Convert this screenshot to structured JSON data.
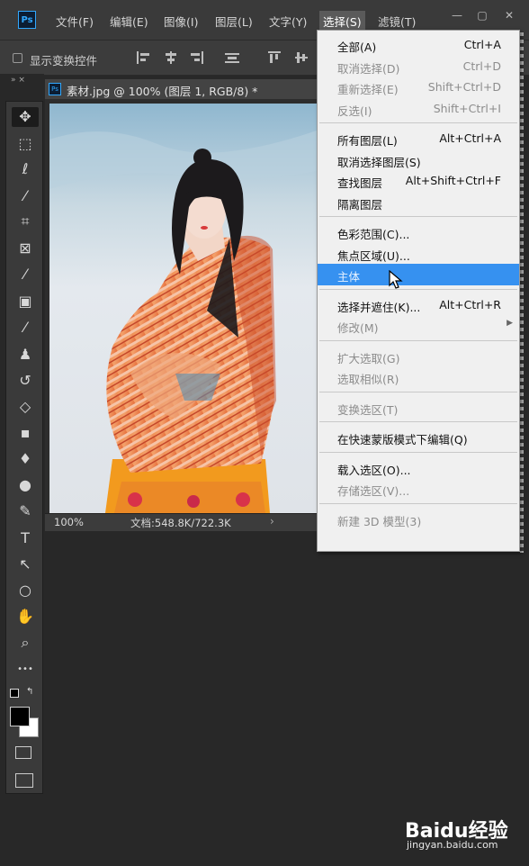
{
  "app": {
    "logo_text": "Ps"
  },
  "menubar": {
    "items": [
      "文件(F)",
      "编辑(E)",
      "图像(I)",
      "图层(L)",
      "文字(Y)",
      "选择(S)",
      "滤镜(T)"
    ],
    "active_index": 5
  },
  "window_controls": {
    "minimize": "—",
    "restore": "▢",
    "close": "✕"
  },
  "options_bar": {
    "show_transform_controls": "显示变换控件",
    "checked": false
  },
  "document": {
    "tab_title": "素材.jpg @ 100% (图层 1, RGB/8) *",
    "zoom": "100%",
    "doc_info": "文档:548.8K/722.3K",
    "status_arrow": "›"
  },
  "toolbar": {
    "collapse_label": "» ×",
    "tools": [
      {
        "name": "move-tool",
        "glyph": "✥"
      },
      {
        "name": "marquee-tool",
        "glyph": "⬚"
      },
      {
        "name": "lasso-tool",
        "glyph": "ℓ"
      },
      {
        "name": "magic-wand-tool",
        "glyph": "⁄"
      },
      {
        "name": "crop-tool",
        "glyph": "⌗"
      },
      {
        "name": "frame-tool",
        "glyph": "⊠"
      },
      {
        "name": "eyedropper-tool",
        "glyph": "⁄"
      },
      {
        "name": "healing-brush-tool",
        "glyph": "▣"
      },
      {
        "name": "brush-tool",
        "glyph": "⁄"
      },
      {
        "name": "stamp-tool",
        "glyph": "♟"
      },
      {
        "name": "history-brush-tool",
        "glyph": "↺"
      },
      {
        "name": "eraser-tool",
        "glyph": "◇"
      },
      {
        "name": "gradient-tool",
        "glyph": "▪"
      },
      {
        "name": "blur-tool",
        "glyph": "♦"
      },
      {
        "name": "dodge-tool",
        "glyph": "●"
      },
      {
        "name": "pen-tool",
        "glyph": "✎"
      },
      {
        "name": "type-tool",
        "glyph": "T"
      },
      {
        "name": "path-selection-tool",
        "glyph": "↖"
      },
      {
        "name": "ellipse-tool",
        "glyph": "○"
      },
      {
        "name": "hand-tool",
        "glyph": "✋"
      },
      {
        "name": "zoom-tool",
        "glyph": "⌕"
      },
      {
        "name": "more-tools",
        "glyph": "•••"
      }
    ]
  },
  "select_menu": {
    "items": [
      {
        "label": "全部(A)",
        "shortcut": "Ctrl+A",
        "disabled": false
      },
      {
        "label": "取消选择(D)",
        "shortcut": "Ctrl+D",
        "disabled": true
      },
      {
        "label": "重新选择(E)",
        "shortcut": "Shift+Ctrl+D",
        "disabled": true
      },
      {
        "label": "反选(I)",
        "shortcut": "Shift+Ctrl+I",
        "disabled": true
      },
      {
        "sep": true
      },
      {
        "label": "所有图层(L)",
        "shortcut": "Alt+Ctrl+A",
        "disabled": false
      },
      {
        "label": "取消选择图层(S)",
        "shortcut": "",
        "disabled": false
      },
      {
        "label": "查找图层",
        "shortcut": "Alt+Shift+Ctrl+F",
        "disabled": false
      },
      {
        "label": "隔离图层",
        "shortcut": "",
        "disabled": false
      },
      {
        "sep": true
      },
      {
        "label": "色彩范围(C)...",
        "shortcut": "",
        "disabled": false
      },
      {
        "label": "焦点区域(U)...",
        "shortcut": "",
        "disabled": false
      },
      {
        "label": "主体",
        "shortcut": "",
        "disabled": false,
        "highlight": true
      },
      {
        "sep": true
      },
      {
        "label": "选择并遮住(K)...",
        "shortcut": "Alt+Ctrl+R",
        "disabled": false
      },
      {
        "label": "修改(M)",
        "shortcut": "",
        "disabled": true,
        "submenu": true
      },
      {
        "sep": true
      },
      {
        "label": "扩大选取(G)",
        "shortcut": "",
        "disabled": true
      },
      {
        "label": "选取相似(R)",
        "shortcut": "",
        "disabled": true
      },
      {
        "sep": true
      },
      {
        "label": "变换选区(T)",
        "shortcut": "",
        "disabled": true
      },
      {
        "sep": true
      },
      {
        "label": "在快速蒙版模式下编辑(Q)",
        "shortcut": "",
        "disabled": false
      },
      {
        "sep": true
      },
      {
        "label": "载入选区(O)...",
        "shortcut": "",
        "disabled": false
      },
      {
        "label": "存储选区(V)...",
        "shortcut": "",
        "disabled": true
      },
      {
        "sep": true
      },
      {
        "label": "新建 3D 模型(3)",
        "shortcut": "",
        "disabled": true
      }
    ]
  },
  "watermark": {
    "logo": "Baidu经验",
    "url": "jingyan.baidu.com"
  },
  "colors": {
    "menu_highlight": "#3691f0",
    "accent": "#31a8ff"
  }
}
